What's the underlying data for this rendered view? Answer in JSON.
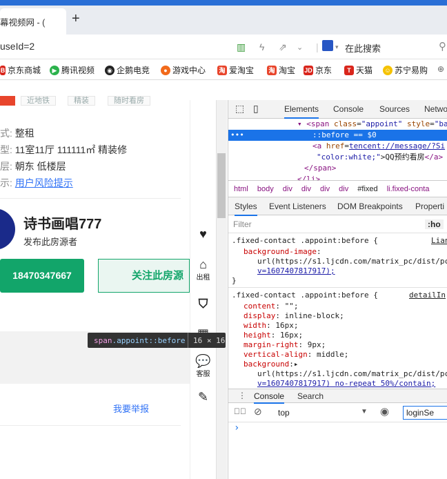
{
  "browser": {
    "tab_title": "幕视频网 - (",
    "new_tab": "+",
    "url": "useId=2",
    "search_label": "在此搜索",
    "bookmarks": [
      "京东商城",
      "腾讯视频",
      "企鹅电竞",
      "游戏中心",
      "爱淘宝",
      "淘宝",
      "京东",
      "天猫",
      "苏宁易购"
    ]
  },
  "page": {
    "chips": [
      "近地铁",
      "精装",
      "随时看房"
    ],
    "rows": [
      {
        "key": "式:",
        "value": "整租"
      },
      {
        "key": "型:",
        "value": "11室11厅 111111㎡ 精装修"
      },
      {
        "key": "层:",
        "value": "朝东 低楼层"
      },
      {
        "key": "示:",
        "value": "用户风险提示"
      }
    ],
    "agent_name": "诗书画唱777",
    "agent_sub": "发布此房源者",
    "phone": "18470347667",
    "follow": "关注此房源",
    "report": "我要举报"
  },
  "sidebar": {
    "items": [
      {
        "label": ""
      },
      {
        "label": "出租"
      },
      {
        "label": ""
      },
      {
        "label": ""
      },
      {
        "label": "客服"
      },
      {
        "label": ""
      }
    ]
  },
  "tooltip": {
    "selector": "span",
    "cls": ".appoint::before",
    "size": "16 × 16"
  },
  "devtools": {
    "tabs": [
      "Elements",
      "Console",
      "Sources",
      "Netwo"
    ],
    "dom": {
      "l1_tag": "<span",
      "l1_attr": "class",
      "l1_val": "\"appoint\"",
      "l1_attr2": "style",
      "l1_val2": "\"bac",
      "l2": "::before == $0",
      "l3_tag": "<a",
      "l3_attr": "href",
      "l3_val": "tencent://message/?Si",
      "l4_val": "\"color:white;\"",
      "l4_text": "QQ预约看房",
      "l4_close": "</a>",
      "l5": "</span>",
      "l6": "</li>"
    },
    "crumbs": [
      "html",
      "body",
      "div",
      "div",
      "div",
      "div",
      "#fixed",
      "li.fixed-conta"
    ],
    "subtabs": [
      "Styles",
      "Event Listeners",
      "DOM Breakpoints",
      "Properti"
    ],
    "filter_placeholder": "Filter",
    "filter_right": ":ho",
    "rule1": {
      "selector": ".fixed-contact .appoint:before {",
      "source": "Lian",
      "prop": "background-image",
      "url1": "url(https://s1.ljcdn.com/matrix_pc/dist/pc",
      "url2": "v=1607407817917);",
      "close": "}"
    },
    "rule2": {
      "selector": ".fixed-contact .appoint:before {",
      "source": "detailIn",
      "props": [
        {
          "name": "content",
          "value": "\"\";"
        },
        {
          "name": "display",
          "value": "inline-block;"
        },
        {
          "name": "width",
          "value": "16px;"
        },
        {
          "name": "height",
          "value": "16px;"
        },
        {
          "name": "margin-right",
          "value": "9px;"
        },
        {
          "name": "vertical-align",
          "value": "middle;"
        },
        {
          "name": "background",
          "value": "▸"
        }
      ],
      "url1": "url(https://s1.ljcdn.com/matrix_pc/dist/pc",
      "url2": "v=1607407817917) no-repeat 50%/contain;"
    },
    "drawer_tabs": [
      "Console",
      "Search"
    ],
    "context": "top",
    "console_filter": "loginSe",
    "prompt": "›"
  },
  "colors": {
    "accent": "#12a56a",
    "devtools_selection": "#1a73e8",
    "link": "#3072f6"
  }
}
